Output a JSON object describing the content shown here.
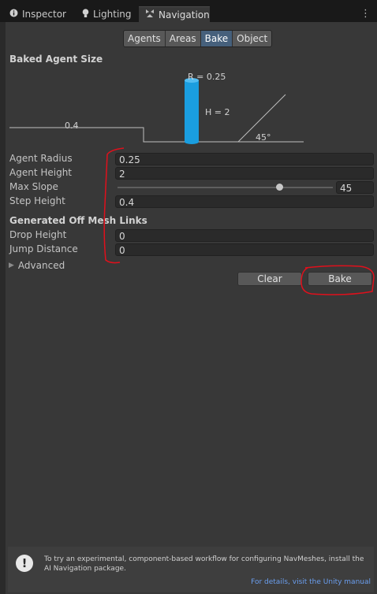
{
  "tabs": [
    {
      "label": "Inspector",
      "icon": "info-icon"
    },
    {
      "label": "Lighting",
      "icon": "bulb-icon"
    },
    {
      "label": "Navigation",
      "icon": "navigation-icon"
    }
  ],
  "toolbar": {
    "items": [
      "Agents",
      "Areas",
      "Bake",
      "Object"
    ],
    "selected": "Bake"
  },
  "baked_agent_size": {
    "heading": "Baked Agent Size",
    "radius_label": "R = 0.25",
    "height_label": "H = 2",
    "step_label": "0.4",
    "slope_label": "45°"
  },
  "fields": {
    "agent_radius": {
      "label": "Agent Radius",
      "value": "0.25"
    },
    "agent_height": {
      "label": "Agent Height",
      "value": "2"
    },
    "max_slope": {
      "label": "Max Slope",
      "value": "45",
      "fraction": 0.75
    },
    "step_height": {
      "label": "Step Height",
      "value": "0.4"
    }
  },
  "off_mesh": {
    "heading": "Generated Off Mesh Links",
    "drop_height": {
      "label": "Drop Height",
      "value": "0"
    },
    "jump_distance": {
      "label": "Jump Distance",
      "value": "0"
    }
  },
  "advanced": {
    "label": "Advanced"
  },
  "buttons": {
    "clear": "Clear",
    "bake": "Bake"
  },
  "footer": {
    "message": "To try an experimental, component-based workflow for configuring NavMeshes, install the AI Navigation package.",
    "link": "For details, visit the Unity manual"
  },
  "colors": {
    "agent": "#1a9ee0",
    "annotation": "#e0101c",
    "selected_tab": "#46607c"
  }
}
